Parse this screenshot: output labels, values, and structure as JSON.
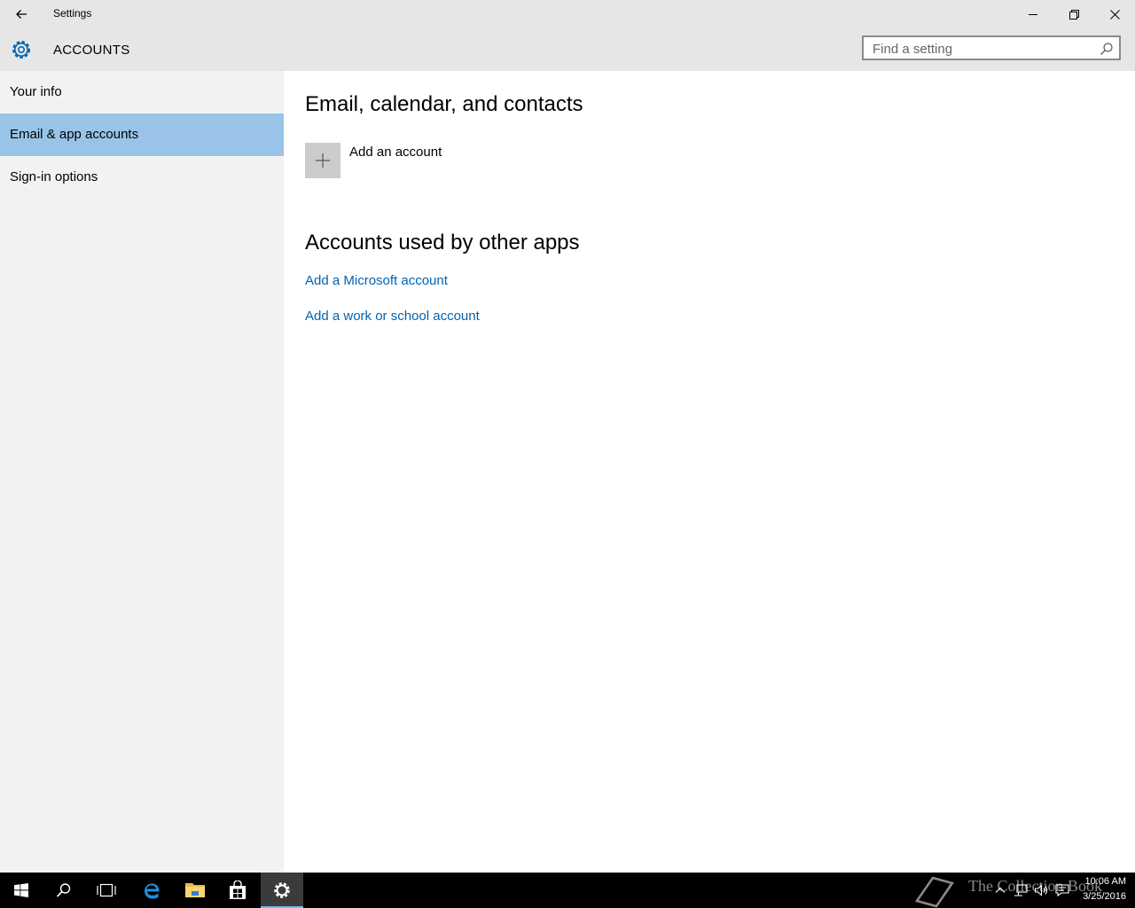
{
  "window": {
    "title": "Settings"
  },
  "header": {
    "section_title": "ACCOUNTS",
    "search_placeholder": "Find a setting"
  },
  "sidebar": {
    "items": [
      {
        "label": "Your info",
        "active": false
      },
      {
        "label": "Email & app accounts",
        "active": true
      },
      {
        "label": "Sign-in options",
        "active": false
      }
    ]
  },
  "main": {
    "section1_title": "Email, calendar, and contacts",
    "add_account_label": "Add an account",
    "section2_title": "Accounts used by other apps",
    "links": [
      "Add a Microsoft account",
      "Add a work or school account"
    ]
  },
  "taskbar": {
    "apps": [
      "start-icon",
      "search-icon",
      "task-view-icon",
      "edge-icon",
      "file-explorer-icon",
      "store-icon",
      "settings-gear-icon"
    ],
    "watermark": "The Collection Book",
    "time": "10:06 AM",
    "date": "3/25/2016"
  },
  "colors": {
    "accent": "#0063b1",
    "selected_nav": "#99c4e8",
    "titlebar": "#e6e6e6",
    "sidebar": "#f2f2f2",
    "taskbar": "#000000"
  }
}
